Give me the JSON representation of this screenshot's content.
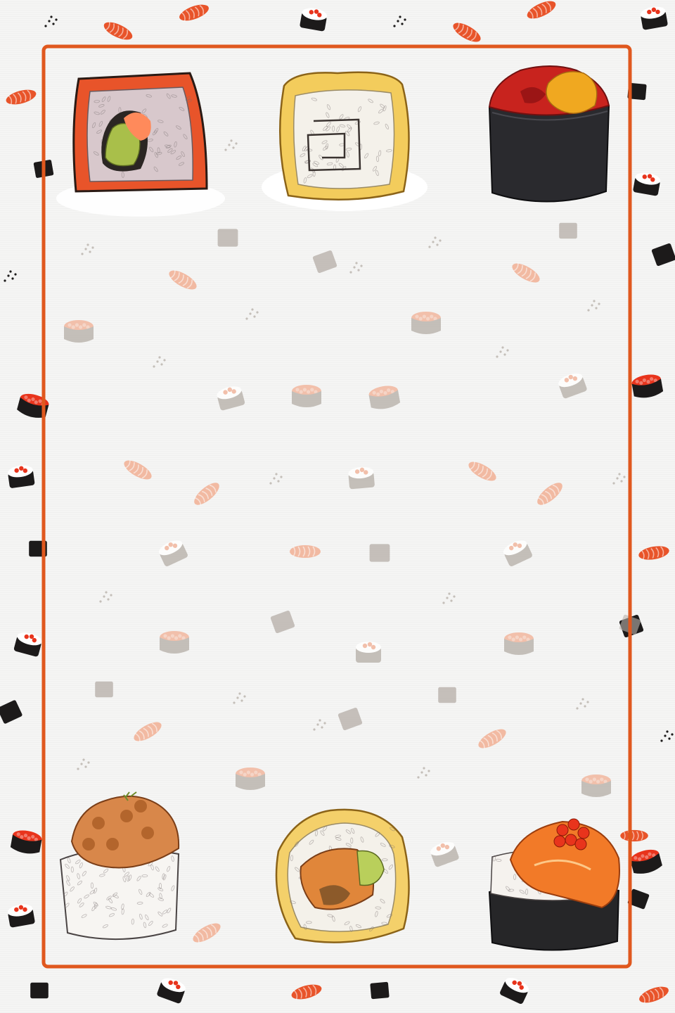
{
  "poster": {
    "text": [],
    "frame": {
      "shape": "rounded-rectangle",
      "style": "outline",
      "color": "#e0581e"
    },
    "colors": {
      "background": "#f5f5f4",
      "frame": "#e0581e",
      "salmon": "#e8542a",
      "salmon_light": "#f2b49a",
      "roe": "#e8341c",
      "nori": "#1c1a1a",
      "rice": "#ffffff",
      "pattern_grey": "#b9b2ab"
    },
    "illustrations": [
      {
        "name": "salmon-avocado-roll",
        "corner": "top-left"
      },
      {
        "name": "tempura-fried-roll",
        "corner": "top-center"
      },
      {
        "name": "tuna-gunkan",
        "corner": "top-right"
      },
      {
        "name": "topped-rice-ball",
        "corner": "bottom-left"
      },
      {
        "name": "tempura-filled-roll",
        "corner": "bottom-center"
      },
      {
        "name": "salmon-roe-gunkan",
        "corner": "bottom-right"
      }
    ],
    "pattern": "scattered-sushi-icons"
  }
}
